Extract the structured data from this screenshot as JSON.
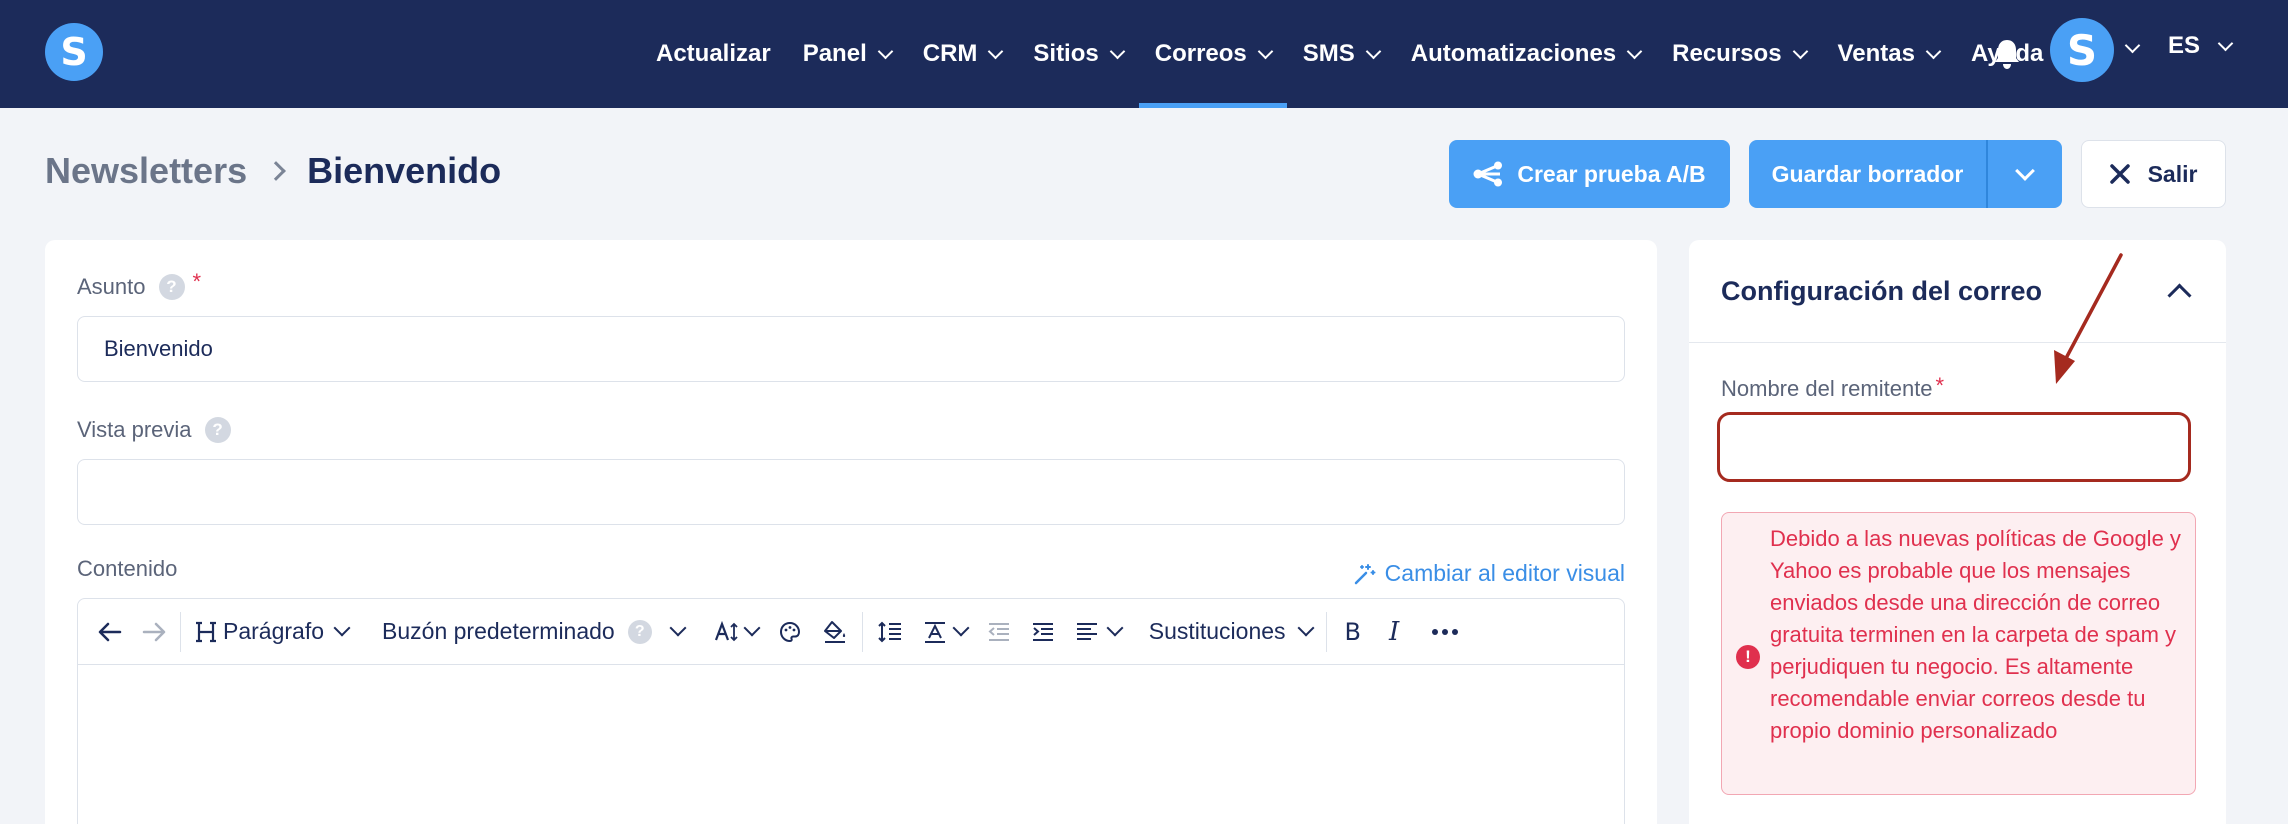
{
  "nav": {
    "logo": "S",
    "items": [
      {
        "label": "Actualizar",
        "dropdown": false
      },
      {
        "label": "Panel",
        "dropdown": true
      },
      {
        "label": "CRM",
        "dropdown": true
      },
      {
        "label": "Sitios",
        "dropdown": true
      },
      {
        "label": "Correos",
        "dropdown": true,
        "active": true
      },
      {
        "label": "SMS",
        "dropdown": true
      },
      {
        "label": "Automatizaciones",
        "dropdown": true
      },
      {
        "label": "Recursos",
        "dropdown": true
      },
      {
        "label": "Ventas",
        "dropdown": true
      },
      {
        "label": "Ayuda",
        "dropdown": false
      }
    ],
    "avatar": "S",
    "language": "ES"
  },
  "breadcrumb": {
    "parent": "Newsletters",
    "current": "Bienvenido"
  },
  "actions": {
    "ab_test": "Crear prueba A/B",
    "save_draft": "Guardar borrador",
    "exit": "Salir"
  },
  "form": {
    "subject_label": "Asunto",
    "subject_value": "Bienvenido",
    "required_mark": "*",
    "help_mark": "?",
    "preview_label": "Vista previa",
    "preview_value": "",
    "content_label": "Contenido",
    "visual_editor_link": "Cambiar al editor visual"
  },
  "toolbar": {
    "paragraph": "Parágrafo",
    "mailbox": "Buzón predeterminado",
    "substitutions": "Sustituciones",
    "bold": "B",
    "italic": "I"
  },
  "sidebar": {
    "title": "Configuración del correo",
    "sender_label": "Nombre del remitente",
    "sender_value": "",
    "alert_text": "Debido a las nuevas políticas de Google y Yahoo es probable que los mensajes enviados desde una dirección de correo gratuita terminen en la carpeta de spam y perjudiquen tu negocio. Es altamente recomendable enviar correos desde tu propio dominio personalizado",
    "alert_icon": "!"
  },
  "colors": {
    "nav_bg": "#1c2b5a",
    "accent": "#4aa0f5",
    "error": "#e0304e",
    "annotation": "#a52a1f"
  }
}
